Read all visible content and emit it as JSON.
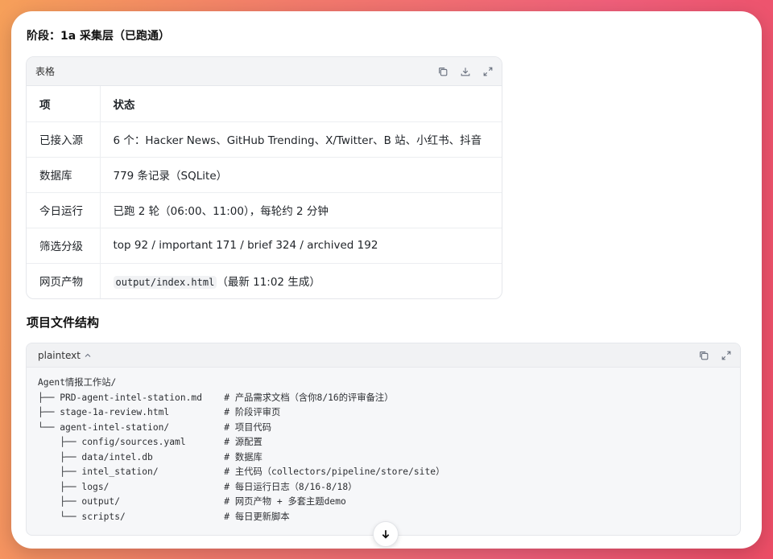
{
  "stage_title": "阶段：1a 采集层（已跑通）",
  "table": {
    "label": "表格",
    "headers": [
      "项",
      "状态"
    ],
    "rows": [
      {
        "item": "已接入源",
        "status": "6 个：Hacker News、GitHub Trending、X/Twitter、B 站、小红书、抖音"
      },
      {
        "item": "数据库",
        "status": "779 条记录（SQLite）"
      },
      {
        "item": "今日运行",
        "status": "已跑 2 轮（06:00、11:00），每轮约 2 分钟"
      },
      {
        "item": "筛选分级",
        "status": "top 92 / important 171 / brief 324 / archived 192"
      },
      {
        "item": "网页产物",
        "status_code": "output/index.html",
        "status_suffix": "（最新 11:02 生成）"
      }
    ]
  },
  "section_title": "项目文件结构",
  "code_block": {
    "lang": "plaintext",
    "lines": [
      "Agent情报工作站/",
      "├── PRD-agent-intel-station.md    # 产品需求文档（含你8/16的评审备注）",
      "├── stage-1a-review.html          # 阶段评审页",
      "└── agent-intel-station/          # 项目代码",
      "    ├── config/sources.yaml       # 源配置",
      "    ├── data/intel.db             # 数据库",
      "    ├── intel_station/            # 主代码（collectors/pipeline/store/site）",
      "    ├── logs/                     # 每日运行日志（8/16-8/18）",
      "    ├── output/                   # 网页产物 + 多套主题demo",
      "    └── scripts/                  # 每日更新脚本"
    ]
  },
  "icons": {
    "copy": "copy-icon",
    "download": "download-icon",
    "expand": "expand-icon",
    "chevron": "chevron-up-icon",
    "scroll": "arrow-down-icon"
  }
}
